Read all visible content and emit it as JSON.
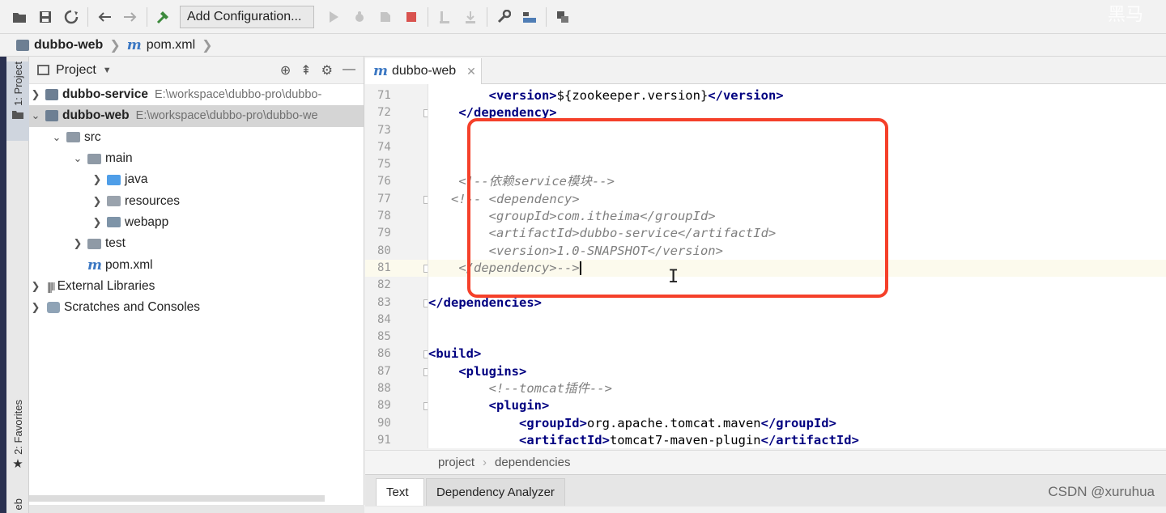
{
  "toolbar": {
    "config_label": "Add Configuration...",
    "watermark": "黑马"
  },
  "navbar": {
    "project": "dubbo-web",
    "file": "pom.xml"
  },
  "left_strip": {
    "project_tab": "1: Project",
    "favorites_tab": "2: Favorites",
    "web_tab": "eb"
  },
  "project_panel": {
    "title": "Project",
    "tree": [
      {
        "label": "dubbo-service",
        "path": "E:\\workspace\\dubbo-pro\\dubbo-"
      },
      {
        "label": "dubbo-web",
        "path": "E:\\workspace\\dubbo-pro\\dubbo-we"
      },
      {
        "label": "src"
      },
      {
        "label": "main"
      },
      {
        "label": "java"
      },
      {
        "label": "resources"
      },
      {
        "label": "webapp"
      },
      {
        "label": "test"
      },
      {
        "label": "pom.xml"
      },
      {
        "label": "External Libraries"
      },
      {
        "label": "Scratches and Consoles"
      }
    ]
  },
  "editor": {
    "tab_label": "dubbo-web",
    "line_numbers": [
      "71",
      "72",
      "73",
      "74",
      "75",
      "76",
      "77",
      "78",
      "79",
      "80",
      "81",
      "82",
      "83",
      "84",
      "85",
      "86",
      "87",
      "88",
      "89",
      "90",
      "91"
    ],
    "code": {
      "l71_open": "<version>",
      "l71_text": "${zookeeper.version}",
      "l71_close": "</version>",
      "l72": "</dependency>",
      "l76": "<!--依赖service模块-->",
      "l77": "<!-- <dependency>",
      "l78": "<groupId>com.itheima</groupId>",
      "l79": "<artifactId>dubbo-service</artifactId>",
      "l80": "<version>1.0-SNAPSHOT</version>",
      "l81": "</dependency>-->",
      "l83": "</dependencies>",
      "l86": "<build>",
      "l87": "<plugins>",
      "l88": "<!--tomcat插件-->",
      "l89": "<plugin>",
      "l90_open": "<groupId>",
      "l90_text": "org.apache.tomcat.maven",
      "l90_close": "</groupId>",
      "l91_open": "<artifactId>",
      "l91_text": "tomcat7-maven-plugin",
      "l91_close": "</artifactId>"
    },
    "breadcrumb": [
      "project",
      "dependencies"
    ]
  },
  "bottom_tabs": {
    "text": "Text",
    "dependency_analyzer": "Dependency Analyzer"
  },
  "watermark_bottom": "CSDN @xuruhua",
  "colors": {
    "highlight": "#f5402a",
    "xml_tag": "#000080",
    "comment": "#808080"
  }
}
